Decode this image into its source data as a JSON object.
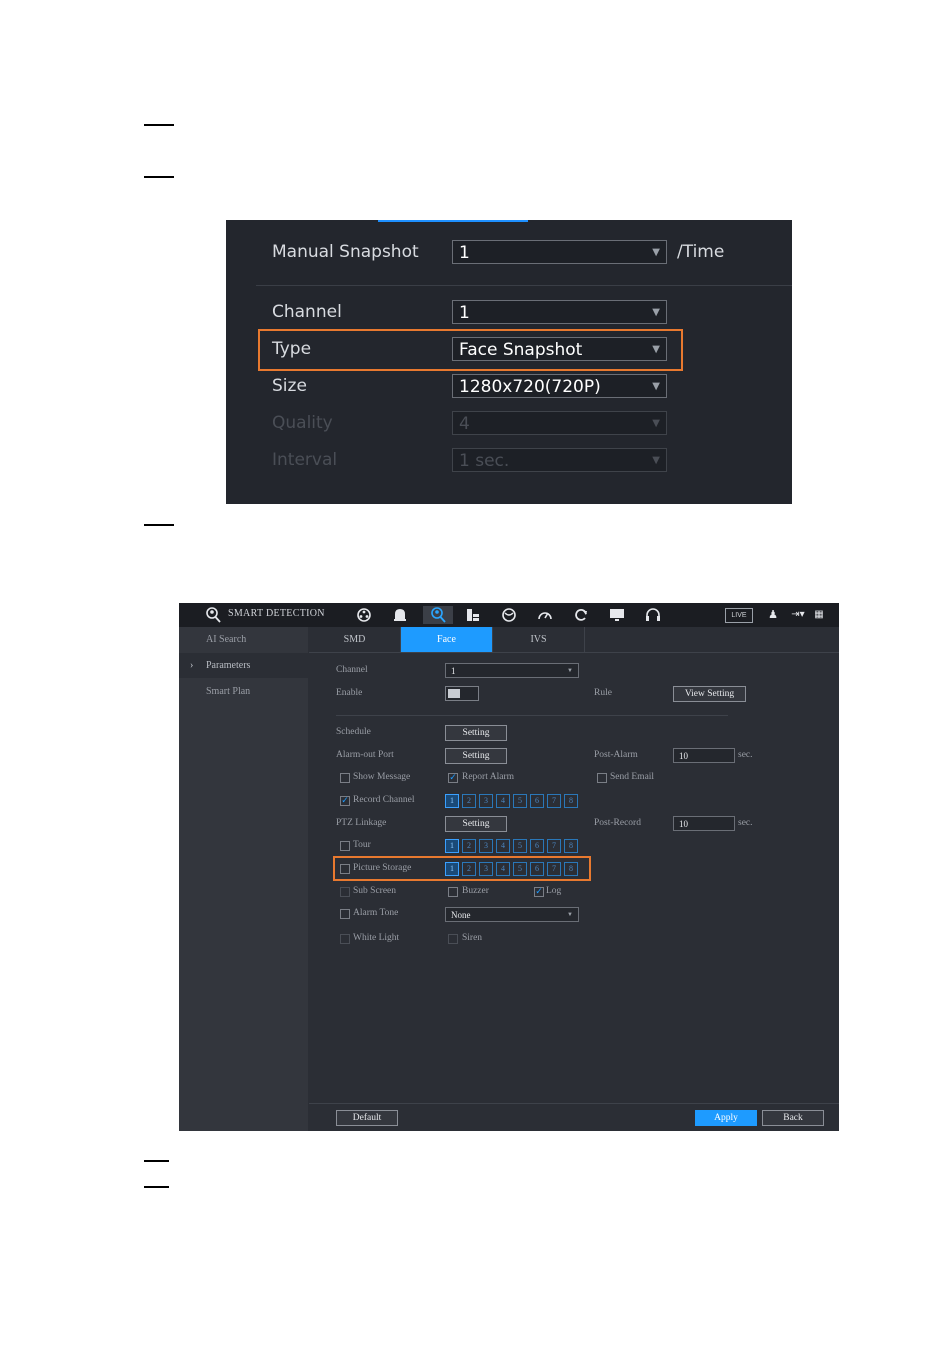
{
  "snapshot_panel": {
    "manual_snapshot": {
      "label": "Manual Snapshot",
      "value": "1",
      "unit": "/Time"
    },
    "channel": {
      "label": "Channel",
      "value": "1"
    },
    "type": {
      "label": "Type",
      "value": "Face Snapshot"
    },
    "size": {
      "label": "Size",
      "value": "1280x720(720P)"
    },
    "quality": {
      "label": "Quality",
      "value": "4"
    },
    "interval": {
      "label": "Interval",
      "value": "1 sec."
    }
  },
  "smart_panel": {
    "title": "SMART DETECTION",
    "live_label": "LIVE",
    "toolbar_icons": [
      "face-search-icon",
      "camera-icon",
      "alarm-bell-icon",
      "face-detection-icon",
      "storage-icon",
      "network-icon",
      "performance-icon",
      "refresh-icon",
      "monitor-icon",
      "headset-icon"
    ],
    "sidebar": {
      "ai_search": "AI Search",
      "parameters": "Parameters",
      "smart_plan": "Smart Plan"
    },
    "tabs": [
      "SMD",
      "Face",
      "IVS"
    ],
    "form": {
      "channel_label": "Channel",
      "channel_value": "1",
      "enable_label": "Enable",
      "rule_label": "Rule",
      "view_setting": "View Setting",
      "schedule_label": "Schedule",
      "setting_label": "Setting",
      "alarm_out_label": "Alarm-out Port",
      "post_alarm_label": "Post-Alarm",
      "post_alarm_value": "10",
      "sec_label": "sec.",
      "show_message": "Show Message",
      "report_alarm": "Report Alarm",
      "send_email": "Send Email",
      "record_channel": "Record Channel",
      "ptz_linkage": "PTZ Linkage",
      "post_record_label": "Post-Record",
      "post_record_value": "10",
      "tour": "Tour",
      "picture_storage": "Picture Storage",
      "sub_screen": "Sub Screen",
      "buzzer": "Buzzer",
      "log": "Log",
      "alarm_tone": "Alarm Tone",
      "alarm_tone_value": "None",
      "white_light": "White Light",
      "siren": "Siren"
    },
    "channels": [
      "1",
      "2",
      "3",
      "4",
      "5",
      "6",
      "7",
      "8"
    ],
    "buttons": {
      "default": "Default",
      "apply": "Apply",
      "back": "Back"
    },
    "accent_color": "#1e9bff",
    "highlight_color": "#e8792f"
  }
}
